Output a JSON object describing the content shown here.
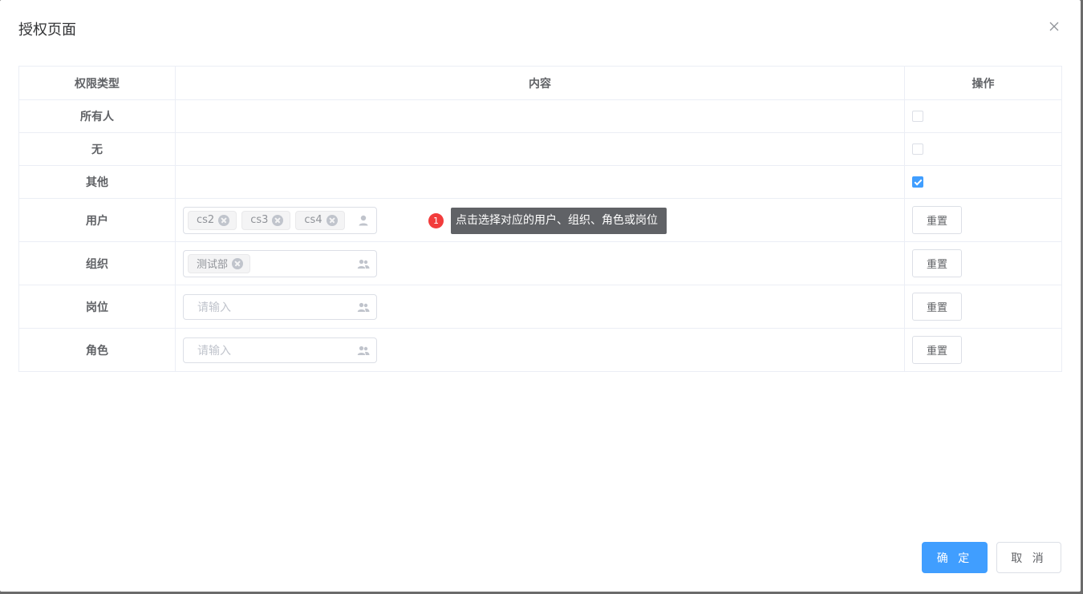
{
  "dialog": {
    "title": "授权页面",
    "confirm_label": "确 定",
    "cancel_label": "取 消"
  },
  "table": {
    "headers": [
      "权限类型",
      "内容",
      "操作"
    ],
    "checkbox_rows": [
      {
        "type": "所有人",
        "checked": false
      },
      {
        "type": "无",
        "checked": false
      },
      {
        "type": "其他",
        "checked": true
      }
    ],
    "select_rows": [
      {
        "type": "用户",
        "tags": [
          "cs2",
          "cs3",
          "cs4"
        ],
        "placeholder": "",
        "icon": "user-icon",
        "reset_label": "重置"
      },
      {
        "type": "组织",
        "tags": [
          "测试部"
        ],
        "placeholder": "",
        "icon": "users-icon",
        "reset_label": "重置"
      },
      {
        "type": "岗位",
        "tags": [],
        "placeholder": "请输入",
        "icon": "users-icon",
        "reset_label": "重置"
      },
      {
        "type": "角色",
        "tags": [],
        "placeholder": "请输入",
        "icon": "users-icon",
        "reset_label": "重置"
      }
    ]
  },
  "hint": {
    "badge": "1",
    "text": "点击选择对应的用户、组织、角色或岗位"
  },
  "colors": {
    "primary": "#409eff",
    "badge": "#f23c3c",
    "tooltip": "#606266"
  }
}
